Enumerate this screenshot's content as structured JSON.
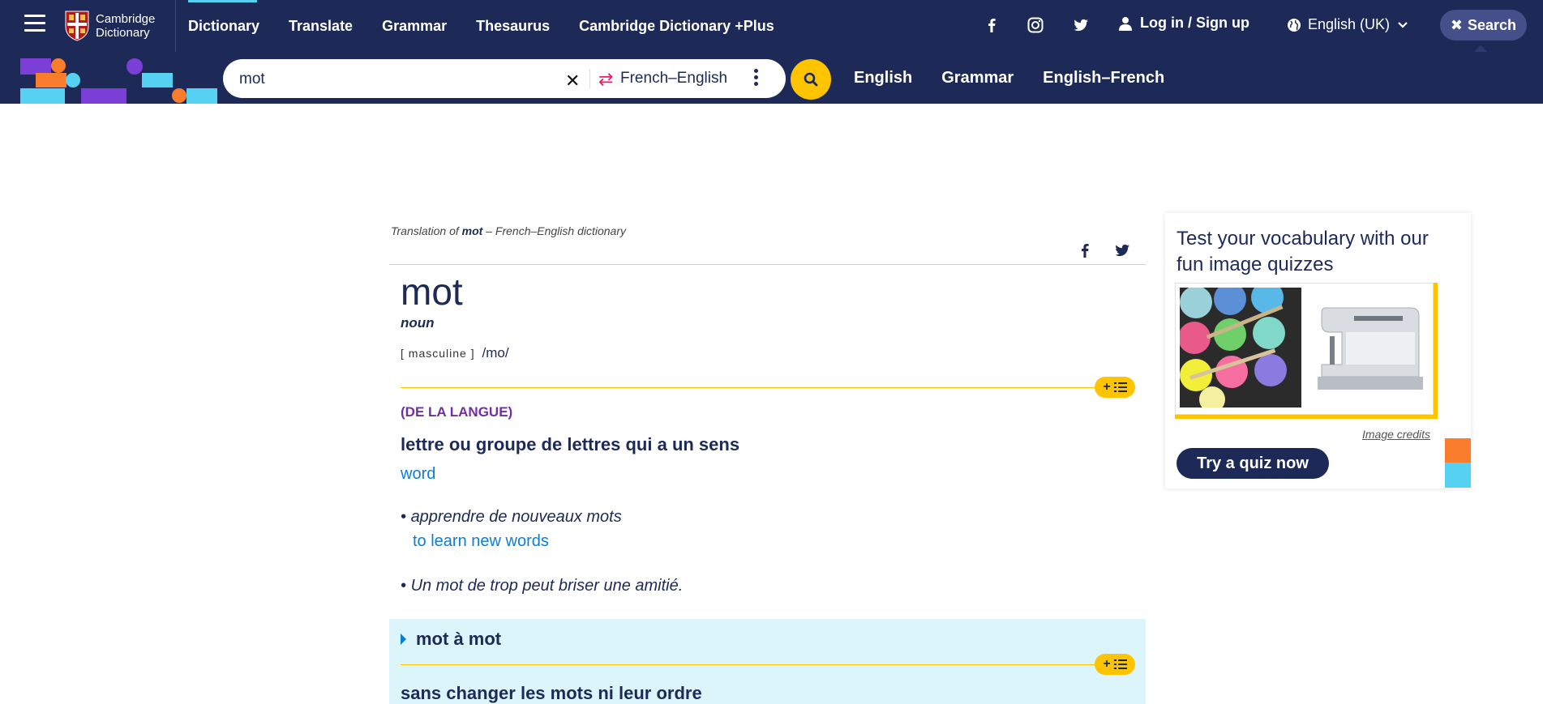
{
  "header": {
    "logo_text_1": "Cambridge",
    "logo_text_2": "Dictionary",
    "nav": [
      "Dictionary",
      "Translate",
      "Grammar",
      "Thesaurus",
      "Cambridge Dictionary +Plus"
    ],
    "login": "Log in / Sign up",
    "language": "English (UK)",
    "search_toggle": "Search"
  },
  "search": {
    "query": "mot",
    "dictionary": "French–English",
    "links": [
      "English",
      "Grammar",
      "English–French"
    ]
  },
  "entry": {
    "crumb_prefix": "Translation of",
    "crumb_word": "mot",
    "crumb_suffix": "– French–English dictionary",
    "headword": "mot",
    "pos": "noun",
    "gram_code": "[ masculine ]",
    "pronunciation": "/mo/",
    "guideword": "(DE LA LANGUE)",
    "definition": "lettre ou groupe de lettres qui a un sens",
    "translation": "word",
    "examples": [
      {
        "text": "apprendre de nouveaux mots",
        "translation": "to learn new words"
      },
      {
        "text": "Un mot de trop peut briser une amitié.",
        "translation": ""
      }
    ],
    "phrase": {
      "title": "mot à mot",
      "definition": "sans changer les mots ni leur ordre"
    }
  },
  "quiz": {
    "title": "Test your vocabulary with our fun image quizzes",
    "credits": "Image credits",
    "button": "Try a quiz now"
  },
  "colors": {
    "navy": "#1d2a57",
    "yellow": "#fec400",
    "link_blue": "#0a7fd8",
    "guide_purple": "#7030a0",
    "phrase_bg": "#dcf5fa"
  }
}
